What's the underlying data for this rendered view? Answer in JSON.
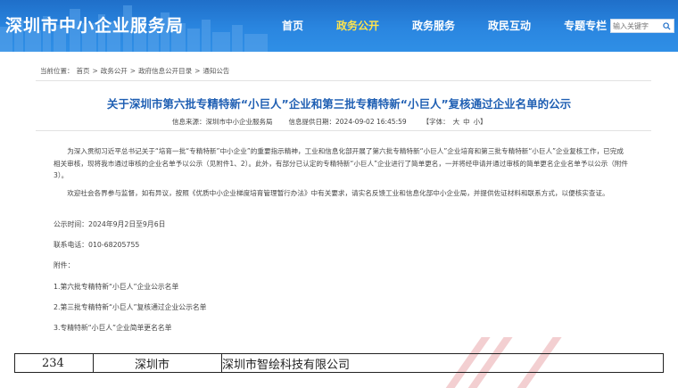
{
  "header": {
    "site_title": "深圳市中小企业服务局",
    "nav": [
      {
        "label": "首页",
        "active": false
      },
      {
        "label": "政务公开",
        "active": true
      },
      {
        "label": "政务服务",
        "active": false
      },
      {
        "label": "政民互动",
        "active": false
      },
      {
        "label": "专题专栏",
        "active": false
      }
    ],
    "search": {
      "placeholder": "输入关键字"
    },
    "colors": {
      "bar": "#2a86e0",
      "active_nav": "#ffe44d"
    }
  },
  "breadcrumb": {
    "label": "当前位置：",
    "items": [
      "首页",
      "政务公开",
      "政府信息公开目录",
      "通知公告"
    ],
    "separator": ">"
  },
  "article": {
    "title": "关于深圳市第六批专精特新“小巨人”企业和第三批专精特新“小巨人”复核通过企业名单的公示",
    "source": "信息来源：深圳市中小企业服务局",
    "date": "信息提供日期：2024-09-02 16:45:59",
    "font_size_label": "【字体：",
    "font_sizes": [
      "大",
      "中",
      "小"
    ],
    "font_size_close": "】",
    "paragraph1": "为深入贯彻习近平总书记关于“培育一批“专精特新”中小企业”的重要指示精神，工业和信息化部开展了第六批专精特新“小巨人”企业培育和第三批专精特新“小巨人”企业复核工作，已完成相关审核，现将我市通过审核的企业名单予以公示（见附件1、2）。此外，有部分已认定的专精特新“小巨人”企业进行了简单更名，一并将经申请并通过审核的简单更名企业名单予以公示（附件3）。",
    "paragraph2": "欢迎社会各界参与监督，如有异议，按照《优质中小企业梯度培育管理暂行办法》中有关要求，请实名反馈工业和信息化部中小企业局，并提供佐证材料和联系方式，以便核实查证。",
    "period": "公示时间：2024年9月2日至9月6日",
    "phone": "联系电话：010-68205755",
    "attachments_label": "附件：",
    "attachments": [
      "1.第六批专精特新“小巨人”企业公示名单",
      "2.第三批专精特新“小巨人”复核通过企业公示名单",
      "3.专精特新“小巨人”企业简单更名名单"
    ],
    "title_color": "#1f5fb3"
  },
  "table_row": {
    "index": "234",
    "city": "深圳市",
    "company": "深圳市智绘科技有限公司"
  }
}
